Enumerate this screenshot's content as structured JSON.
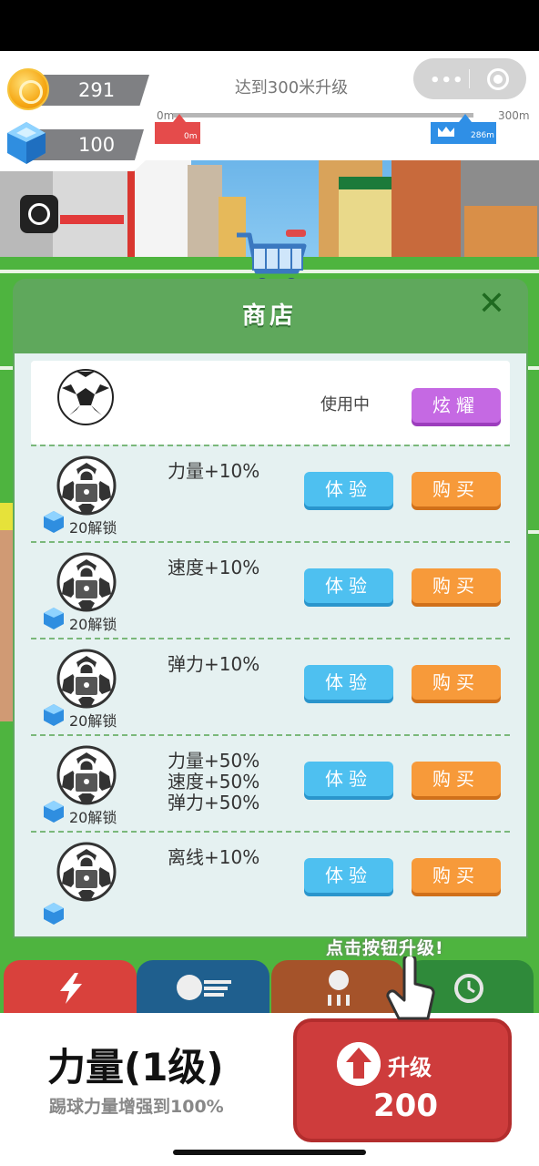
{
  "hud": {
    "coins": "291",
    "gems": "100",
    "goal_text": "达到300米升级",
    "track_start": "0m",
    "track_end": "300m",
    "current_marker": "0m",
    "best_marker": "286m",
    "progress_fraction": 0.0,
    "best_fraction": 0.953
  },
  "shop": {
    "title": "商店",
    "close_glyph": "✕",
    "active_item": {
      "status": "使用中",
      "action": "炫耀"
    },
    "items": [
      {
        "desc": "力量+10%",
        "cost": "20解锁",
        "try": "体验",
        "buy": "购买"
      },
      {
        "desc": "速度+10%",
        "cost": "20解锁",
        "try": "体验",
        "buy": "购买"
      },
      {
        "desc": "弹力+10%",
        "cost": "20解锁",
        "try": "体验",
        "buy": "购买"
      },
      {
        "desc": "力量+50%\n速度+50%\n弹力+50%",
        "cost": "20解锁",
        "try": "体验",
        "buy": "购买"
      },
      {
        "desc": "离线+10%",
        "cost": "",
        "try": "体验",
        "buy": "购买"
      }
    ]
  },
  "hint_text": "点击按钮升级!",
  "tabs": [
    {
      "icon": "lightning-icon",
      "color": "#d9413c"
    },
    {
      "icon": "speed-ball-icon",
      "color": "#1f5f8e"
    },
    {
      "icon": "bounce-icon",
      "color": "#a5532a"
    },
    {
      "icon": "clock-icon",
      "color": "#2f8a3a"
    }
  ],
  "upgrade": {
    "stat_name": "力量(1级)",
    "stat_desc": "踢球力量增强到100%",
    "button_label": "升级",
    "button_cost": "200"
  }
}
